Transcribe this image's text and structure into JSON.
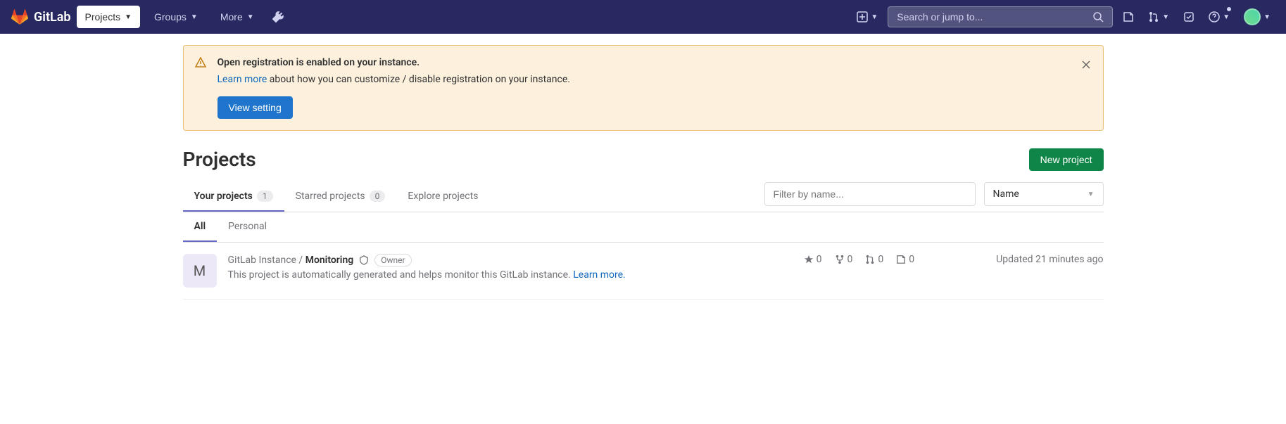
{
  "topbar": {
    "logo_text": "GitLab",
    "nav": {
      "projects": "Projects",
      "groups": "Groups",
      "more": "More"
    },
    "search_placeholder": "Search or jump to..."
  },
  "alert": {
    "title": "Open registration is enabled on your instance.",
    "learn_more": "Learn more",
    "text_rest": " about how you can customize / disable registration on your instance.",
    "button": "View setting"
  },
  "page": {
    "title": "Projects",
    "new_button": "New project"
  },
  "tabs": {
    "your": "Your projects",
    "your_count": "1",
    "starred": "Starred projects",
    "starred_count": "0",
    "explore": "Explore projects",
    "filter_placeholder": "Filter by name...",
    "sort_label": "Name"
  },
  "subtabs": {
    "all": "All",
    "personal": "Personal"
  },
  "project": {
    "avatar_letter": "M",
    "namespace": "GitLab Instance / ",
    "name": "Monitoring",
    "role": "Owner",
    "description_pre": "This project is automatically generated and helps monitor this GitLab instance. ",
    "description_link": "Learn more.",
    "stars": "0",
    "forks": "0",
    "mrs": "0",
    "issues": "0",
    "updated": "Updated 21 minutes ago"
  }
}
